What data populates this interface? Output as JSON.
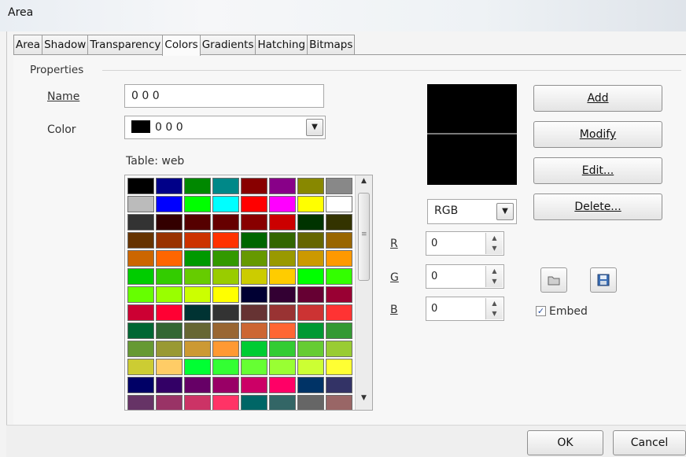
{
  "window": {
    "title": "Area"
  },
  "tabs": [
    "Area",
    "Shadow",
    "Transparency",
    "Colors",
    "Gradients",
    "Hatching",
    "Bitmaps"
  ],
  "active_tab": "Colors",
  "properties": {
    "section_label": "Properties",
    "name_label": "Name",
    "name_value": "0 0 0",
    "color_label": "Color",
    "color_value": "0 0 0",
    "table_label": "Table: web"
  },
  "color_mode": {
    "value": "RGB"
  },
  "rgb": {
    "r_label": "R",
    "r_value": "0",
    "g_label": "G",
    "g_value": "0",
    "b_label": "B",
    "b_value": "0"
  },
  "buttons": {
    "add": "Add",
    "modify": "Modify",
    "edit": "Edit...",
    "delete": "Delete...",
    "ok": "OK",
    "cancel": "Cancel"
  },
  "embed": {
    "label": "Embed",
    "checked": true
  },
  "palette": [
    "#000000",
    "#000088",
    "#008800",
    "#008888",
    "#880000",
    "#880088",
    "#888800",
    "#888888",
    "#bbbbbb",
    "#0000ff",
    "#00ff00",
    "#00ffff",
    "#ff0000",
    "#ff00ff",
    "#ffff00",
    "#ffffff",
    "#333333",
    "#330000",
    "#550000",
    "#660000",
    "#880000",
    "#cc0000",
    "#003300",
    "#333300",
    "#663300",
    "#993300",
    "#cc3300",
    "#ff3300",
    "#006600",
    "#336600",
    "#666600",
    "#996600",
    "#cc6600",
    "#ff6600",
    "#009900",
    "#339900",
    "#669900",
    "#999900",
    "#cc9900",
    "#ff9900",
    "#00cc00",
    "#33cc00",
    "#66cc00",
    "#99cc00",
    "#cccc00",
    "#ffcc00",
    "#00ff00",
    "#33ff00",
    "#66ff00",
    "#99ff00",
    "#ccff00",
    "#ffff00",
    "#000033",
    "#330033",
    "#660033",
    "#990033",
    "#cc0033",
    "#ff0033",
    "#003333",
    "#333333",
    "#663333",
    "#993333",
    "#cc3333",
    "#ff3333",
    "#006633",
    "#336633",
    "#666633",
    "#996633",
    "#cc6633",
    "#ff6633",
    "#009933",
    "#339933",
    "#669933",
    "#999933",
    "#cc9933",
    "#ff9933",
    "#00cc33",
    "#33cc33",
    "#66cc33",
    "#99cc33",
    "#cccc33",
    "#ffcc66",
    "#00ff33",
    "#33ff33",
    "#66ff33",
    "#99ff33",
    "#ccff33",
    "#ffff33",
    "#000066",
    "#330066",
    "#660066",
    "#990066",
    "#cc0066",
    "#ff0066",
    "#003366",
    "#333366",
    "#663366",
    "#993366",
    "#cc3366",
    "#ff3366",
    "#006666",
    "#336666",
    "#666666",
    "#996666"
  ]
}
